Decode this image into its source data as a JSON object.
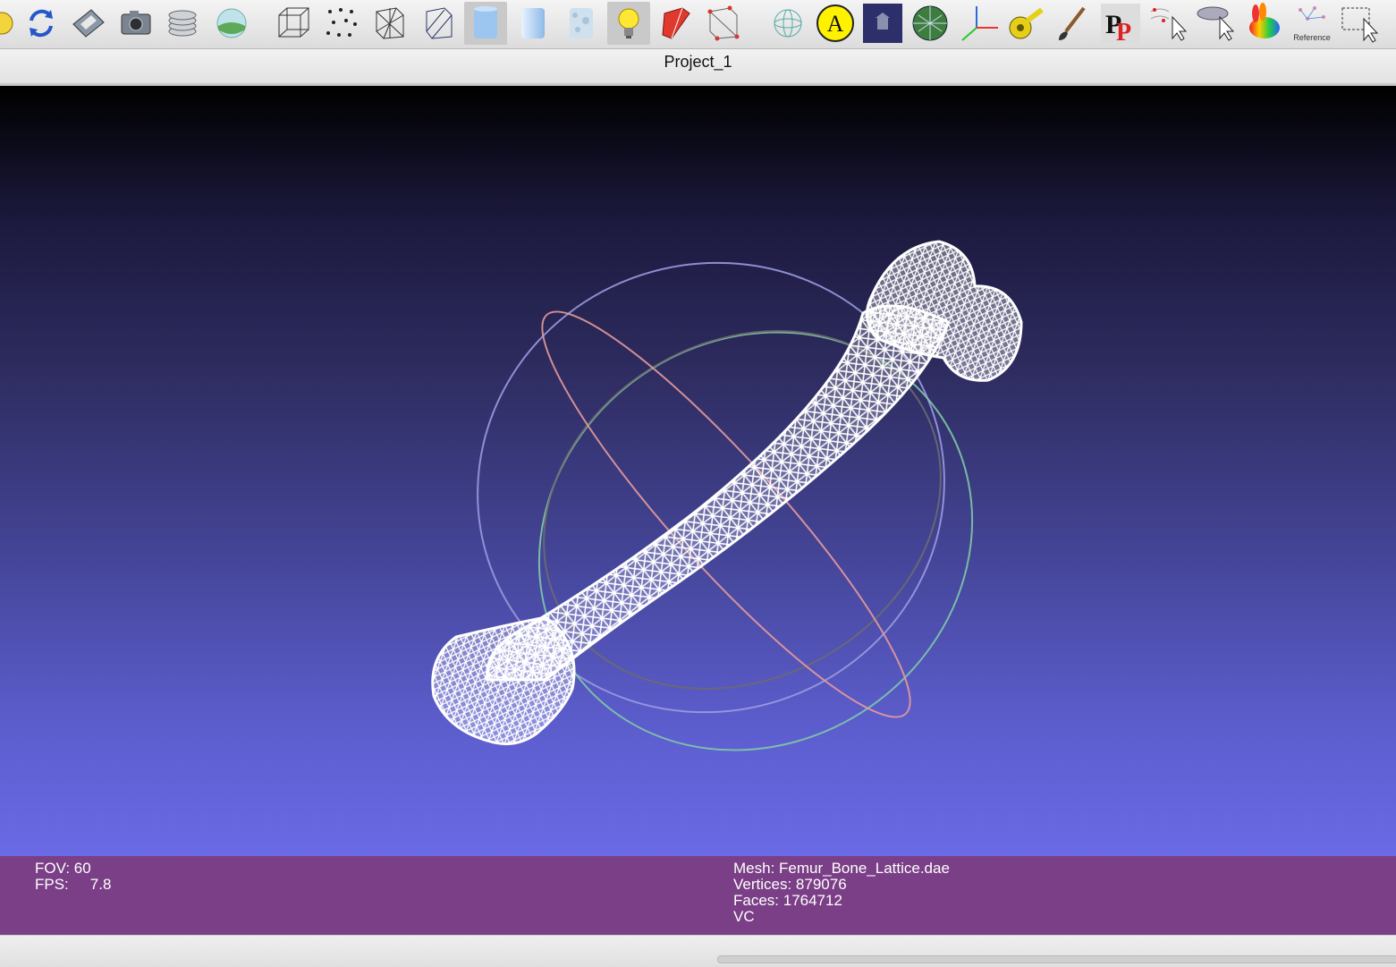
{
  "toolbar": {
    "reference_label": "Reference"
  },
  "window": {
    "title": "Project_1"
  },
  "info": {
    "fov_label": "FOV:",
    "fov_value": "60",
    "fps_label": "FPS:",
    "fps_value": "7.8",
    "mesh_line": "Mesh: Femur_Bone_Lattice.dae",
    "vertices_line": "Vertices: 879076",
    "faces_line": "Faces: 1764712",
    "color_mode": "VC"
  },
  "colors": {
    "info_bar": "#7a3f86",
    "viewport_top": "#000000",
    "viewport_bottom": "#6a6be6"
  }
}
